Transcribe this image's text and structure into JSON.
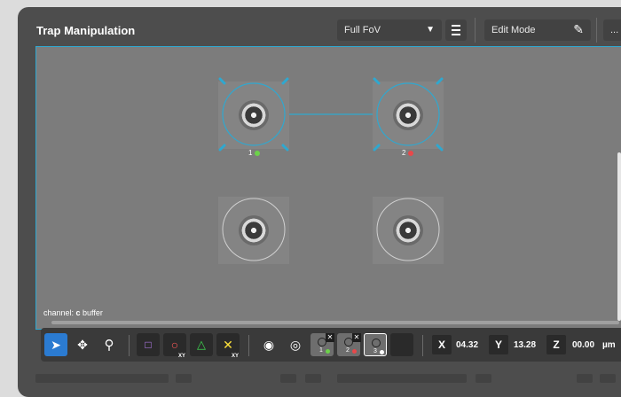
{
  "header": {
    "title": "Trap Manipulation",
    "fov_dropdown": "Full FoV",
    "mode_dropdown": "Edit Mode",
    "overflow_label": "..."
  },
  "viewport": {
    "channel_prefix": "channel: ",
    "channel_letter": "c",
    "channel_suffix": " buffer",
    "traps": [
      {
        "label": "1",
        "status_color": "#6cd24a",
        "selected": true
      },
      {
        "label": "2",
        "status_color": "#e8484a",
        "selected": true
      },
      {
        "label": "",
        "status_color": "",
        "selected": false
      },
      {
        "label": "",
        "status_color": "",
        "selected": false
      }
    ]
  },
  "toolbar": {
    "tools": [
      "pointer-icon",
      "move-icon",
      "zoom-icon"
    ],
    "shapes": [
      {
        "name": "square",
        "color": "#c084ff",
        "sub": ""
      },
      {
        "name": "circle",
        "color": "#ff5a5a",
        "sub": "XY"
      },
      {
        "name": "triangle",
        "color": "#3fd44f",
        "sub": ""
      },
      {
        "name": "cross",
        "color": "#ffe23a",
        "sub": "XY"
      }
    ],
    "trap_slots": [
      {
        "label": "1",
        "color": "#6cd24a"
      },
      {
        "label": "2",
        "color": "#e8484a"
      },
      {
        "label": "3",
        "color": "#ffffff"
      }
    ],
    "x_label": "X",
    "x_value": "04.32",
    "y_label": "Y",
    "y_value": "13.28",
    "z_label": "Z",
    "z_value": "00.00",
    "unit": "µm"
  },
  "colors": {
    "accent": "#2fa8d0",
    "panel": "#4d4d4d",
    "active_tool": "#2b7bd1"
  }
}
